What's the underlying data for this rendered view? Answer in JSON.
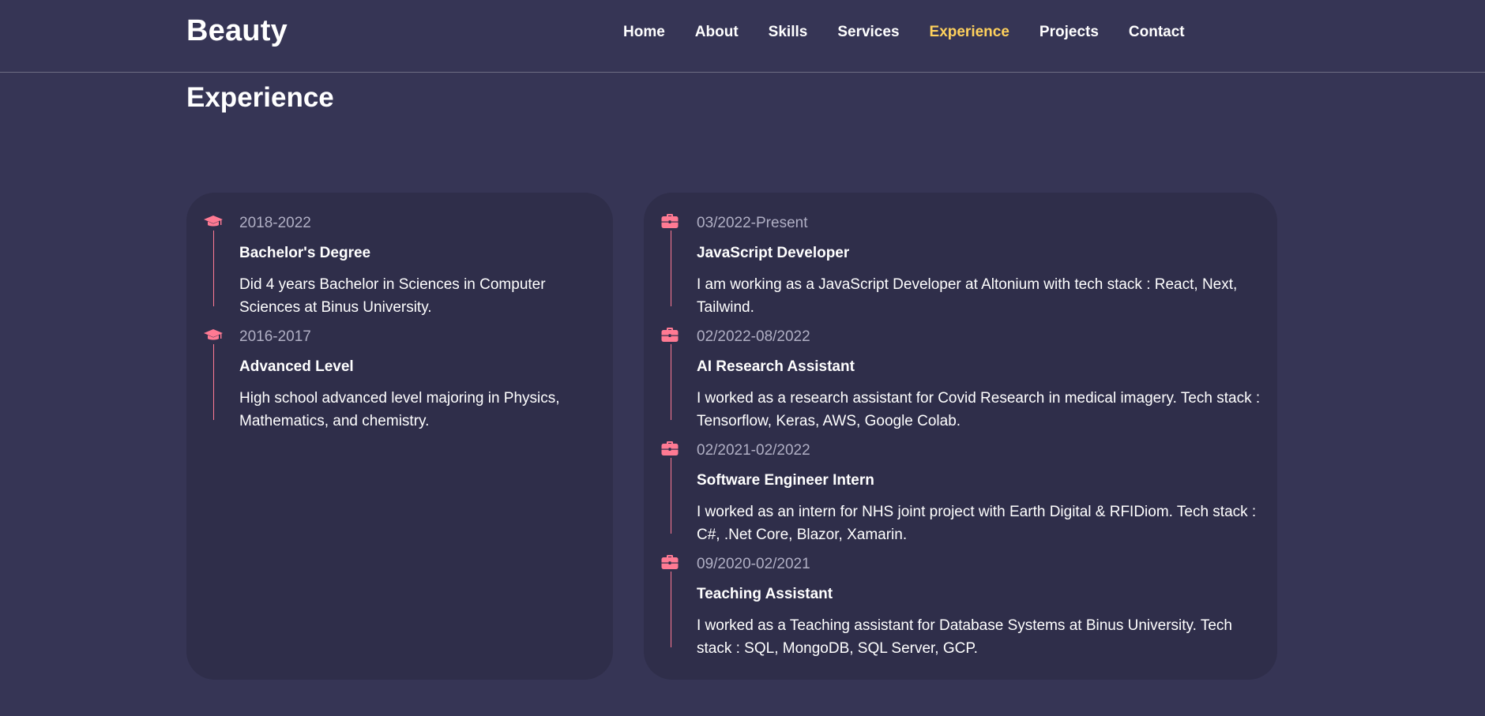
{
  "brand": {
    "logo": "Beauty"
  },
  "nav": {
    "items": [
      {
        "label": "Home"
      },
      {
        "label": "About"
      },
      {
        "label": "Skills"
      },
      {
        "label": "Services"
      },
      {
        "label": "Experience"
      },
      {
        "label": "Projects"
      },
      {
        "label": "Contact"
      }
    ],
    "active": "Experience"
  },
  "section": {
    "title": "Experience"
  },
  "education": [
    {
      "icon": "graduation-cap-icon",
      "date": "2018-2022",
      "title": "Bachelor's Degree",
      "description": "Did 4 years Bachelor in Sciences in Computer Sciences at Binus University."
    },
    {
      "icon": "graduation-cap-icon",
      "date": "2016-2017",
      "title": "Advanced Level",
      "description": "High school advanced level majoring in Physics, Mathematics, and chemistry."
    }
  ],
  "work": [
    {
      "icon": "briefcase-icon",
      "date": "03/2022-Present",
      "title": "JavaScript Developer",
      "description": "I am working as a JavaScript Developer at Altonium with tech stack : React, Next, Tailwind."
    },
    {
      "icon": "briefcase-icon",
      "date": "02/2022-08/2022",
      "title": "AI Research Assistant",
      "description": "I worked as a research assistant for Covid Research in medical imagery. Tech stack : Tensorflow, Keras, AWS, Google Colab."
    },
    {
      "icon": "briefcase-icon",
      "date": "02/2021-02/2022",
      "title": "Software Engineer Intern",
      "description": "I worked as an intern for NHS joint project with Earth Digital & RFIDiom. Tech stack : C#, .Net Core, Blazor, Xamarin."
    },
    {
      "icon": "briefcase-icon",
      "date": "09/2020-02/2021",
      "title": "Teaching Assistant",
      "description": "I worked as a Teaching assistant for Database Systems at Binus University. Tech stack : SQL, MongoDB, SQL Server, GCP."
    }
  ],
  "colors": {
    "background": "#363555",
    "card": "#2f2e4a",
    "accent": "#ff7a93",
    "active_nav": "#ffd15c",
    "muted_text": "#b0afc4"
  }
}
